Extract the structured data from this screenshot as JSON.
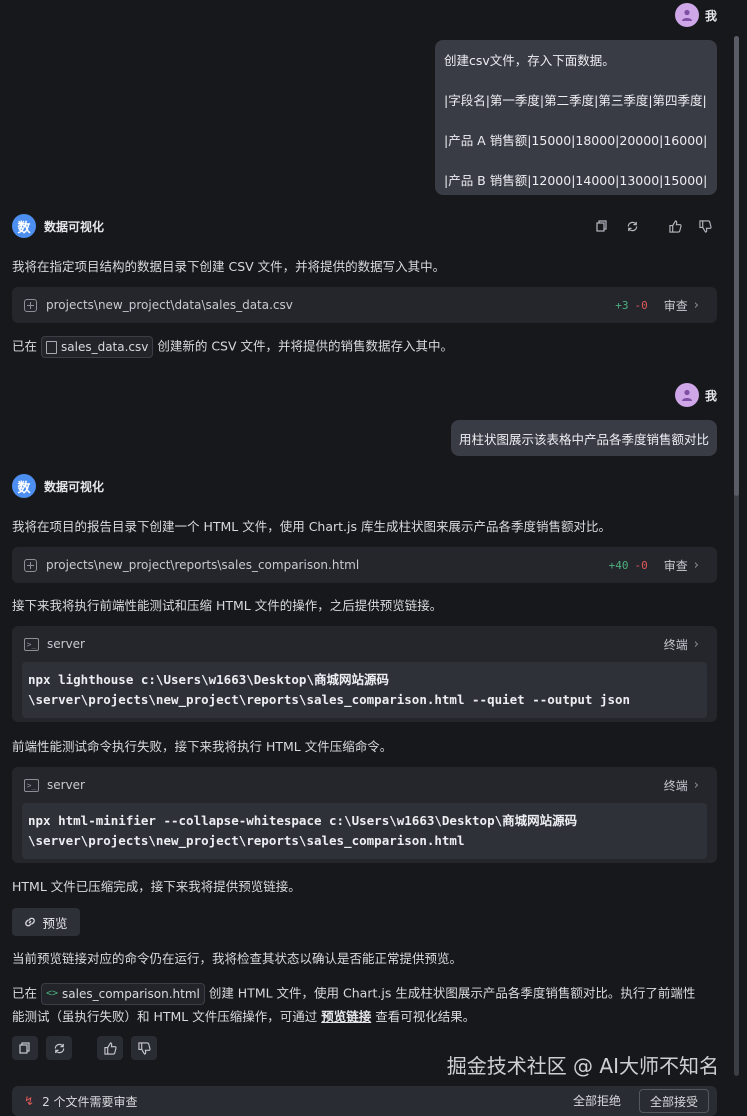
{
  "user": {
    "name": "我",
    "avatar_icon": "person-icon"
  },
  "bot": {
    "name": "数据可视化",
    "avatar_char": "数"
  },
  "messages": {
    "u1": {
      "line1": "创建csv文件，存入下面数据。",
      "line2": "|字段名|第一季度|第二季度|第三季度|第四季度|",
      "line3": "|产品 A 销售额|15000|18000|20000|16000|",
      "line4": "|产品 B 销售额|12000|14000|13000|15000|"
    },
    "b1": {
      "intro": "我将在指定项目结构的数据目录下创建 CSV 文件，并将提供的数据写入其中。",
      "file": {
        "path": "projects\\new_project\\data\\sales_data.csv",
        "add": "+3",
        "del": "-0",
        "action": "审查"
      },
      "done_prefix": "已在",
      "done_file": "sales_data.csv",
      "done_suffix": "创建新的 CSV 文件，并将提供的销售数据存入其中。"
    },
    "u2": {
      "text": "用柱状图展示该表格中产品各季度销售额对比"
    },
    "b2": {
      "intro": "我将在项目的报告目录下创建一个 HTML 文件，使用 Chart.js 库生成柱状图来展示产品各季度销售额对比。",
      "file": {
        "path": "projects\\new_project\\reports\\sales_comparison.html",
        "add": "+40",
        "del": "-0",
        "action": "审查"
      },
      "next1": "接下来我将执行前端性能测试和压缩 HTML 文件的操作，之后提供预览链接。",
      "term1": {
        "title": "server",
        "action": "终端",
        "line1": "npx lighthouse c:\\Users\\w1663\\Desktop\\商城网站源码",
        "line2": "\\server\\projects\\new_project\\reports\\sales_comparison.html --quiet --output json"
      },
      "fail": "前端性能测试命令执行失败，接下来我将执行 HTML 文件压缩命令。",
      "term2": {
        "title": "server",
        "action": "终端",
        "line1": "npx html-minifier --collapse-whitespace c:\\Users\\w1663\\Desktop\\商城网站源码",
        "line2": "\\server\\projects\\new_project\\reports\\sales_comparison.html"
      },
      "compressed": "HTML 文件已压缩完成，接下来我将提供预览链接。",
      "preview_label": "预览",
      "checking": "当前预览链接对应的命令仍在运行，我将检查其状态以确认是否能正常提供预览。",
      "summary_prefix": "已在",
      "summary_file": "sales_comparison.html",
      "summary_mid": "创建 HTML 文件，使用 Chart.js 生成柱状图展示产品各季度销售额对比。执行了前端性",
      "summary_line2_prefix": "能测试（虽执行失败）和 HTML 文件压缩操作，可通过",
      "summary_link": "预览链接",
      "summary_suffix": "查看可视化结果。"
    }
  },
  "bottom_bar": {
    "text": "2 个文件需要审查",
    "reject_all": "全部拒绝",
    "accept_all": "全部接受"
  },
  "watermark": "掘金技术社区 @ AI大师不知名",
  "colors": {
    "background": "#17181c",
    "bubble": "#3a3c45",
    "card": "#24262c",
    "add": "#4caf7d",
    "del": "#e05858",
    "bot_avatar": "#4d8ff0",
    "user_avatar": "#cfa6e8"
  }
}
